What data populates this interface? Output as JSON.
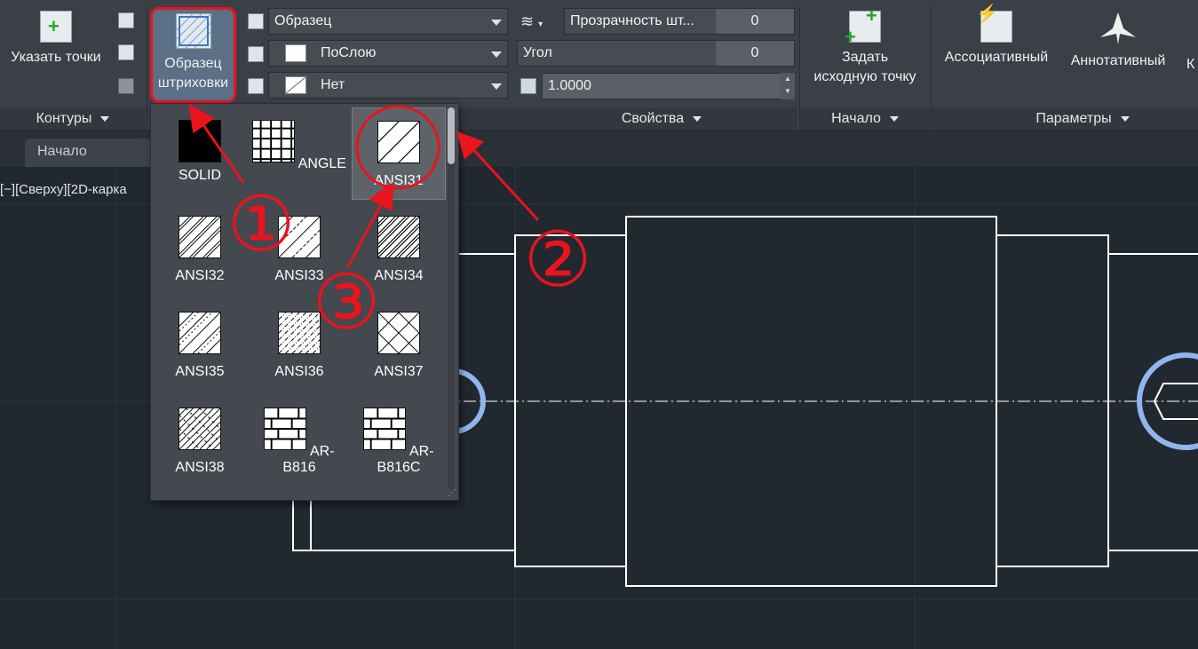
{
  "ribbon": {
    "pick_points_label": "Указать точки",
    "hatch_pattern_button_line1": "Образец",
    "hatch_pattern_button_line2": "штриховки",
    "set_origin_line1": "Задать",
    "set_origin_line2": "исходную точку",
    "associative_label": "Ассоциативный",
    "annotative_label": "Аннотативный",
    "cut_label": "К",
    "panels": {
      "boundaries": "Контуры",
      "properties": "Свойства",
      "origin": "Начало",
      "options": "Параметры"
    },
    "properties": {
      "type_combo": "Образец",
      "color_combo": "ПоСлою",
      "background_combo": "Нет",
      "transparency_label": "Прозрачность шт...",
      "transparency_value": "0",
      "angle_label": "Угол",
      "angle_value": "0",
      "scale_value": "1.0000"
    }
  },
  "tabs": {
    "start": "Начало"
  },
  "viewport": {
    "label": "[−][Сверху][2D-карка"
  },
  "gallery": {
    "items": [
      {
        "label": "SOLID",
        "pattern": "solid"
      },
      {
        "label": "ANGLE",
        "pattern": "angle"
      },
      {
        "label": "ANSI31",
        "pattern": "ansi31",
        "selected": true
      },
      {
        "label": "ANSI32",
        "pattern": "ansi32"
      },
      {
        "label": "ANSI33",
        "pattern": "ansi33"
      },
      {
        "label": "ANSI34",
        "pattern": "ansi34"
      },
      {
        "label": "ANSI35",
        "pattern": "ansi35"
      },
      {
        "label": "ANSI36",
        "pattern": "ansi36"
      },
      {
        "label": "ANSI37",
        "pattern": "ansi37"
      },
      {
        "label": "ANSI38",
        "pattern": "ansi38"
      },
      {
        "label": "AR-B816",
        "pattern": "brick"
      },
      {
        "label": "AR-B816C",
        "pattern": "brick"
      }
    ]
  },
  "annotations": {
    "marker1": "①",
    "marker2": "②",
    "marker3": "③",
    "color": "#e8141e"
  }
}
